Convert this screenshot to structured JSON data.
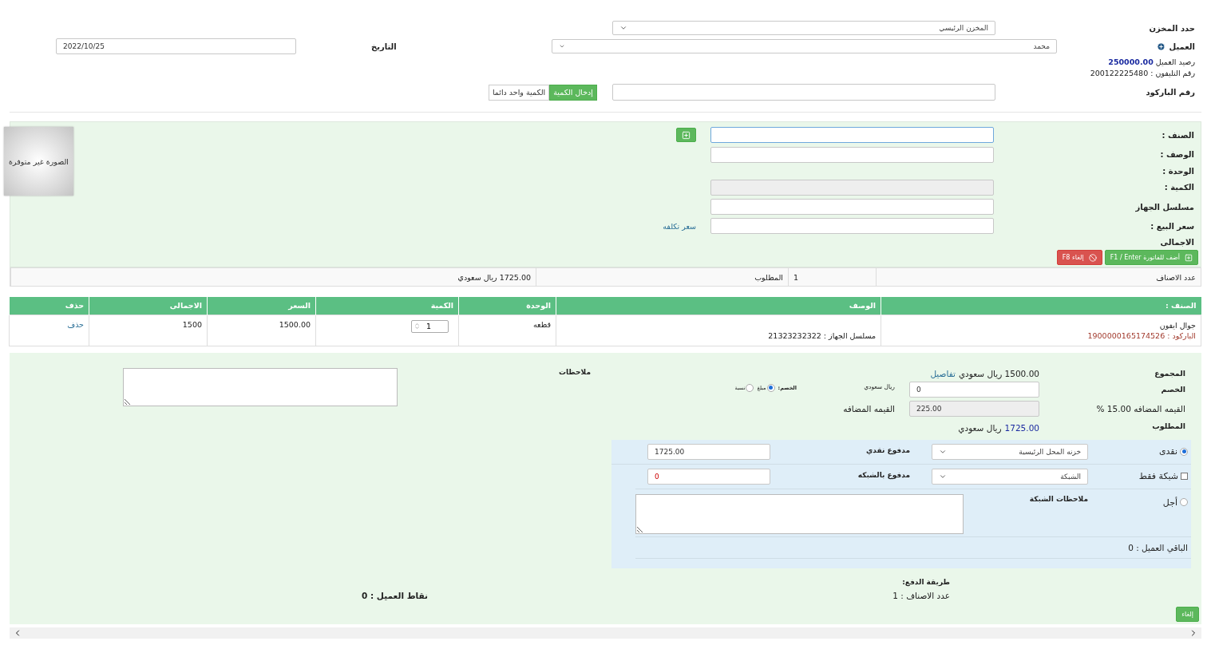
{
  "header": {
    "warehouse": {
      "label": "حدد المخزن",
      "value": "المخزن الرئيسي"
    },
    "customer": {
      "label": "العميل",
      "value": "محمد"
    },
    "date": {
      "label": "التاريخ",
      "value": "2022/10/25"
    },
    "balance": "رصيد العميل **250000.00**",
    "phone": "رقم التليفون : 200122225480",
    "barcode": {
      "label": "رقم الباركود"
    },
    "quantity_modes": [
      {
        "label": "إدخال الكمية",
        "selected": true
      },
      {
        "label": "الكمية واحد دائما",
        "selected": false
      }
    ]
  },
  "item_entry": {
    "fields": [
      {
        "label": "الصنف :",
        "kind": "input",
        "focused": true
      },
      {
        "label": "الوصف :",
        "kind": "input",
        "focused": false
      },
      {
        "label": "الوحدة :",
        "kind": "none"
      },
      {
        "label": "الكمية :",
        "kind": "disabled"
      },
      {
        "label": "مسلسل الجهاز",
        "kind": "input",
        "focused": false
      },
      {
        "label": "سعر البيع :",
        "kind": "input",
        "focused": false
      },
      {
        "label": "الاجمالى",
        "kind": "none"
      }
    ],
    "cost_link": "سعر تكلفه",
    "image_placeholder": "الصورة غير متوفرة",
    "add_button": "أضف للفاتورة F1 / Enter",
    "cancel_button": "إلغاء F8"
  },
  "summary": [
    "عدد الاصناف",
    "1",
    "المطلوب",
    "1725.00 ريال سعودي"
  ],
  "table": {
    "columns": [
      "الصنف :",
      "الوصف",
      "الوحدة",
      "الكمية",
      "السعر",
      "الاجمالى",
      "حذف"
    ],
    "rows": [
      {
        "item": "جوال ايفون",
        "barcode": "الباركود : 1900000165174526",
        "description": "مسلسل الجهاز : 21323232322",
        "unit": "قطعه",
        "quantity": "1",
        "price": "1500.00",
        "total": "1500",
        "delete": "حذف"
      }
    ]
  },
  "totals": {
    "sum": {
      "label": "المجموع",
      "value": "1500.00 ريال سعودي",
      "link": "تفاصيل"
    },
    "discount": {
      "label": "الخصم",
      "value": "0",
      "currency": "ريال سعودي",
      "type_label": "الخصم:",
      "types": [
        {
          "label": "مبلغ",
          "selected": true
        },
        {
          "label": "نسبة",
          "selected": false
        }
      ]
    },
    "vat": {
      "label": "القيمه المضافه 15.00 %",
      "value": "225.00",
      "side_label": "القيمه المضافه"
    },
    "due": {
      "label": "المطلوب",
      "amount": "1725.00",
      "currency": "ريال سعودي"
    }
  },
  "notes": {
    "label": "ملاحظات"
  },
  "payment": {
    "methods": [
      {
        "kind": "radio",
        "label": "نقدى",
        "selected": true,
        "account": "خزنه المحل الرئيسية",
        "amount_label": "مدفوع نقدي",
        "amount": "1725.00"
      },
      {
        "kind": "checkbox",
        "label": "شبكة فقط",
        "checked": false,
        "account": "الشبكة",
        "amount_label": "مدفوع بالشبكه",
        "amount": "0"
      },
      {
        "kind": "radio",
        "label": "أجل",
        "selected": false,
        "notes_label": "ملاحظات الشبكة"
      }
    ],
    "remaining": "الباقي العميل : 0"
  },
  "footer": {
    "payment_method_label": "طريقة الدفع:",
    "items_count": "عدد الاصناف :  1",
    "points": "نقاط العميل : 0",
    "cancel_button": "إلغاء"
  }
}
